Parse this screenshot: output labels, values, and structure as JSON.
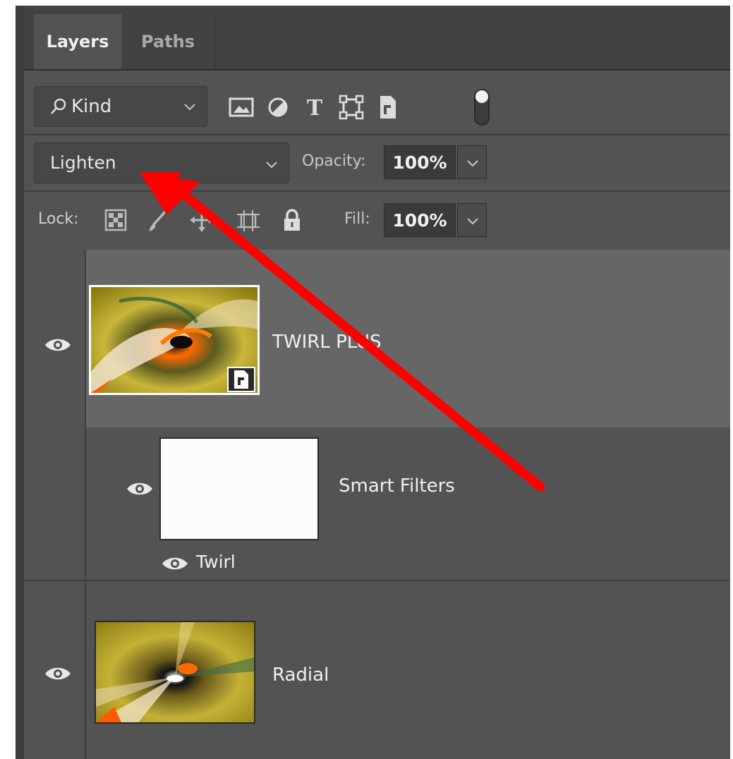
{
  "tabs": {
    "layers": "Layers",
    "paths": "Paths"
  },
  "filter": {
    "kind_label": "Kind",
    "icons": [
      "image-filter-icon",
      "adjustment-filter-icon",
      "type-filter-icon",
      "shape-filter-icon",
      "smart-object-filter-icon",
      "filter-toggle-icon"
    ]
  },
  "blend": {
    "mode": "Lighten",
    "opacity_label": "Opacity:",
    "opacity_value": "100%"
  },
  "lock": {
    "label": "Lock:",
    "icons": [
      "lock-transparent-pixels-icon",
      "lock-image-pixels-icon",
      "lock-position-icon",
      "lock-artboard-icon",
      "lock-all-icon"
    ],
    "fill_label": "Fill:",
    "fill_value": "100%"
  },
  "layers": [
    {
      "name": "TWIRL PLUS",
      "selected": true,
      "visible": true,
      "smart_object": true
    },
    {
      "name": "Smart Filters",
      "visible": true,
      "filters": [
        {
          "name": "Twirl",
          "visible": true
        }
      ]
    },
    {
      "name": "Radial",
      "visible": true
    }
  ],
  "annotation": {
    "arrow_color": "#ff0000",
    "points_to": "blend-mode-select"
  },
  "colors": {
    "panel_bg": "#535353",
    "selected_layer_bg": "#666666",
    "tabbar_bg": "#424242"
  }
}
